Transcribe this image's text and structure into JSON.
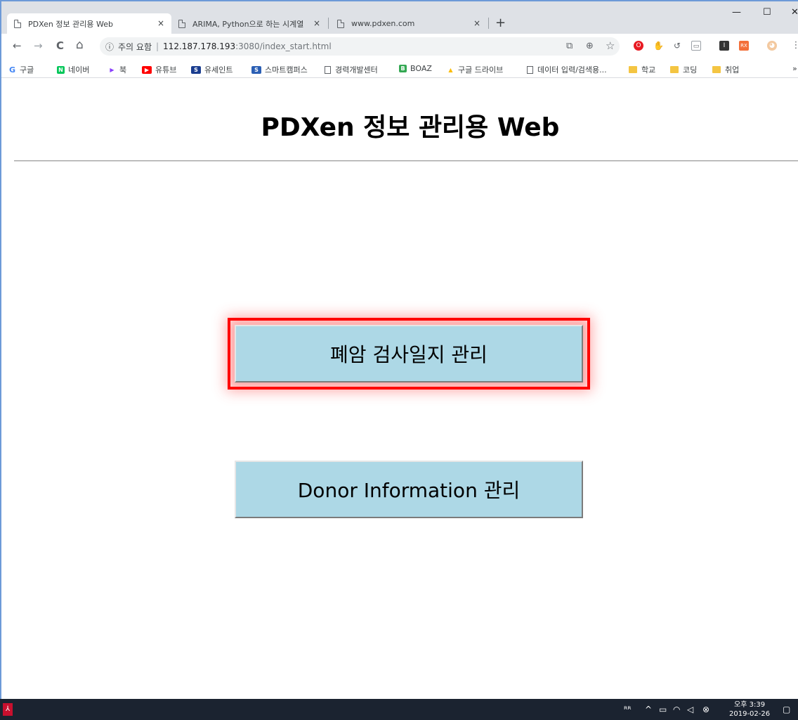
{
  "browser": {
    "tabs": [
      {
        "title": "PDXen 정보 관리용 Web",
        "close": "×"
      },
      {
        "title": "ARIMA, Python으로 하는 시계열",
        "close": "×"
      },
      {
        "title": "www.pdxen.com",
        "close": "×"
      }
    ],
    "new_tab": "+",
    "window": {
      "minimize": "—",
      "maximize": "☐",
      "close": "✕"
    },
    "nav": {
      "back": "←",
      "forward": "→",
      "reload": "C",
      "home": "⌂"
    },
    "omnibox": {
      "info_icon": "ⓘ",
      "security_label": "주의 요함",
      "separator": "|",
      "url_host": "112.187.178.193",
      "url_path": ":3080/index_start.html"
    },
    "bookmarks": [
      {
        "label": "구글",
        "icon": "G",
        "color": "#4285f4"
      },
      {
        "label": "네이버",
        "icon": "N",
        "color": "#03c75a"
      },
      {
        "label": "북",
        "icon": "▶",
        "color": "#8a3ffc"
      },
      {
        "label": "유튜브",
        "icon": "▶",
        "color": "#ff0000"
      },
      {
        "label": "유세인트",
        "icon": "S",
        "color": "#1a3d8f"
      },
      {
        "label": "스마트캠퍼스",
        "icon": "S",
        "color": "#2b5fb4"
      },
      {
        "label": "경력개발센터",
        "icon": "page",
        "color": "#5f6368"
      },
      {
        "label": "BOAZ",
        "icon": "B",
        "color": "#34a853"
      },
      {
        "label": "구글 드라이브",
        "icon": "▲",
        "color": "#fbbc04"
      },
      {
        "label": "데이터 입력/검색용...",
        "icon": "page",
        "color": "#5f6368"
      },
      {
        "label": "학교",
        "icon": "folder",
        "color": "#f4c542"
      },
      {
        "label": "코딩",
        "icon": "folder",
        "color": "#f4c542"
      },
      {
        "label": "취업",
        "icon": "folder",
        "color": "#f4c542"
      }
    ],
    "bookmarks_overflow": "»"
  },
  "page": {
    "title": "PDXen 정보 관리용 Web",
    "buttons": {
      "lung": "폐암 검사일지 관리",
      "donor": "Donor Information 관리"
    }
  },
  "taskbar": {
    "time": "오후 3:39",
    "date": "2019-02-26"
  },
  "colors": {
    "button_bg": "#add8e6",
    "highlight": "#ff0000",
    "taskbar": "#1b2330"
  }
}
